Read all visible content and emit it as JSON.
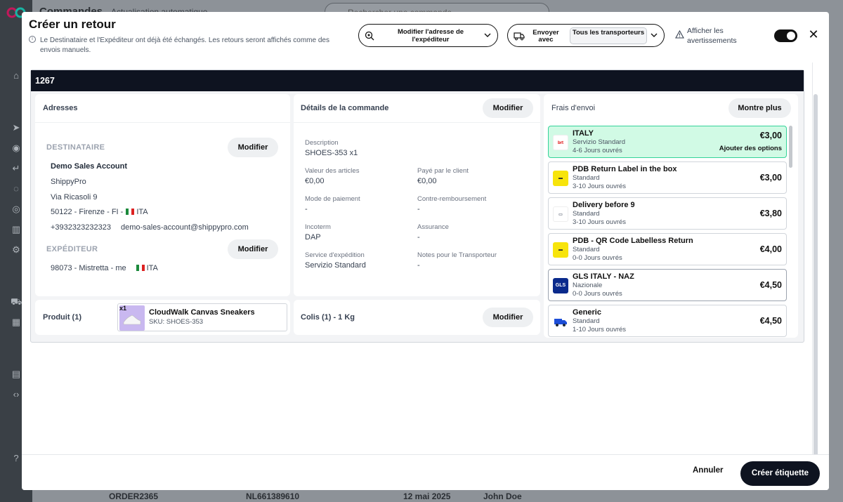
{
  "background": {
    "page_title": "Commandes",
    "auto_update": "Actualisation automatique",
    "search_placeholder": "Rechercher une commande",
    "row": {
      "order_id": "ORDER2365",
      "tracking": "NL661389610",
      "date": "12 mai 2025",
      "customer": "John Doe"
    }
  },
  "modal": {
    "title": "Créer un retour",
    "info_text": "Le Destinataire et l'Expéditeur ont déjà été échangés. Les retours seront affichés comme des envois manuels.",
    "modify_address_label": "Modifier l'adresse de l'expéditeur",
    "send_with_label": "Envoyer avec",
    "carrier_select_value": "Tous les transporteurs",
    "show_warnings_label": "Afficher les avertissements",
    "show_warnings_on": true
  },
  "order": {
    "number": "1267",
    "addresses": {
      "header": "Adresses",
      "recipient_label": "DESTINATAIRE",
      "recipient_modify": "Modifier",
      "recipient_name": "Demo Sales Account",
      "recipient_company": "ShippyPro",
      "recipient_street": "Via Ricasoli 9",
      "recipient_city": "50122 - Firenze - FI -",
      "recipient_country": "ITA",
      "recipient_phone": "+3932323232323",
      "recipient_email": "demo-sales-account@shippypro.com",
      "sender_label": "EXPÉDITEUR",
      "sender_modify": "Modifier",
      "sender_city": "98073 - Mistretta - me",
      "sender_country": "ITA"
    },
    "details": {
      "header": "Détails de la commande",
      "modify": "Modifier",
      "description_label": "Description",
      "description_value": "SHOES-353 x1",
      "items_value_label": "Valeur des articles",
      "items_value": "€0,00",
      "paid_by_client_label": "Payé par le client",
      "paid_by_client": "€0,00",
      "payment_mode_label": "Mode de paiement",
      "payment_mode": "-",
      "cod_label": "Contre-remboursement",
      "cod": "-",
      "incoterm_label": "Incoterm",
      "incoterm": "DAP",
      "insurance_label": "Assurance",
      "insurance": "-",
      "shipping_service_label": "Service d'expédition",
      "shipping_service": "Servizio Standard",
      "carrier_notes_label": "Notes pour le Transporteur",
      "carrier_notes": "-"
    },
    "product": {
      "header": "Produit (1)",
      "qty": "x1",
      "name": "CloudWalk Canvas Sneakers",
      "sku": "SKU: SHOES-353"
    },
    "parcels": {
      "header": "Colis (1) - 1 Kg",
      "modify": "Modifier"
    },
    "rates": {
      "header": "Frais d'envoi",
      "show_more": "Montre plus",
      "add_options": "Ajouter des options",
      "items": [
        {
          "name": "ITALY",
          "service": "Servizio Standard",
          "days": "4-6 Jours ouvrés",
          "price": "€3,00",
          "logo": "brt"
        },
        {
          "name": "PDB Return Label in the box",
          "service": "Standard",
          "days": "3-10 Jours ouvrés",
          "price": "€3,00",
          "logo": "poste"
        },
        {
          "name": "Delivery before 9",
          "service": "Standard",
          "days": "3-10 Jours ouvrés",
          "price": "€3,80",
          "logo": "courier"
        },
        {
          "name": "PDB - QR Code Labelless Return",
          "service": "Standard",
          "days": "0-0 Jours ouvrés",
          "price": "€4,00",
          "logo": "poste"
        },
        {
          "name": "GLS ITALY - NAZ",
          "service": "Nazionale",
          "days": "0-0 Jours ouvrés",
          "price": "€4,50",
          "logo": "GLS"
        },
        {
          "name": "Generic",
          "service": "Standard",
          "days": "1-10 Jours ouvrés",
          "price": "€4,50",
          "logo": "truck"
        }
      ]
    }
  },
  "footer": {
    "cancel": "Annuler",
    "create": "Créer étiquette"
  }
}
